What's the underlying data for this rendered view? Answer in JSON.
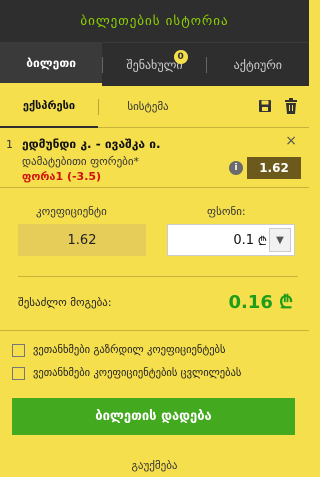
{
  "header": {
    "title": "ბილეთების ისტორია"
  },
  "tabs": [
    {
      "label": "ბილეთი"
    },
    {
      "label": "შენახული",
      "badge": "0"
    },
    {
      "label": "აქტიური"
    }
  ],
  "subtabs": [
    {
      "label": "ექსპრესი"
    },
    {
      "label": "სისტემა"
    }
  ],
  "actions": {
    "save_icon": "save-icon",
    "trash_icon": "trash-icon"
  },
  "bet": {
    "number": "1",
    "title": "ედმუნდი კ. - ივაშკა ი.",
    "market": "დამატებითი ფორები*",
    "pick": "ფორა1 (-3.5)",
    "odds": "1.62",
    "info_icon": "i",
    "close_icon": "×"
  },
  "form": {
    "coef_label": "კოეფიციენტი",
    "coef_value": "1.62",
    "stake_label": "ფსონი:",
    "stake_value": "0.1",
    "currency": "₾",
    "dropdown_icon": "▼"
  },
  "winnings": {
    "label": "შესაძლო მოგება:",
    "value": "0.16 ₾"
  },
  "options": [
    {
      "label": "ვეთანხმები გაზრდილ კოეფიციენტებს"
    },
    {
      "label": "ვეთანხმები კოეფიციენტების ცვლილებას"
    }
  ],
  "primary_button": {
    "label": "ბილეთის დადება"
  },
  "cancel": {
    "label": "გაუქმება"
  },
  "colors": {
    "header_bg": "#2e2e2e",
    "accent_green": "#8fd400",
    "panel_yellow": "#f5df4d",
    "odds_bg": "#6b5a1b",
    "win_green": "#1f9d18",
    "button_green": "#43a91f",
    "pick_red": "#d11010"
  }
}
